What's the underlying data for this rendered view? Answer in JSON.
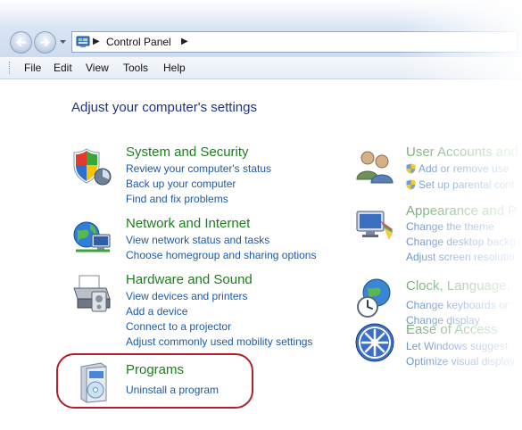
{
  "address": {
    "crumb": "Control Panel"
  },
  "menu": {
    "items": [
      "File",
      "Edit",
      "View",
      "Tools",
      "Help"
    ]
  },
  "page": {
    "heading": "Adjust your computer's settings"
  },
  "categories": {
    "system": {
      "title": "System and Security",
      "links": [
        "Review your computer's status",
        "Back up your computer",
        "Find and fix problems"
      ]
    },
    "network": {
      "title": "Network and Internet",
      "links": [
        "View network status and tasks",
        "Choose homegroup and sharing options"
      ]
    },
    "hardware": {
      "title": "Hardware and Sound",
      "links": [
        "View devices and printers",
        "Add a device",
        "Connect to a projector",
        "Adjust commonly used mobility settings"
      ]
    },
    "programs": {
      "title": "Programs",
      "links": [
        "Uninstall a program"
      ]
    },
    "users": {
      "title": "User Accounts and",
      "links": [
        "Add or remove use",
        "Set up parental cont"
      ]
    },
    "appearance": {
      "title": "Appearance and P",
      "links": [
        "Change the theme",
        "Change desktop backg",
        "Adjust screen resolutio"
      ]
    },
    "clock": {
      "title": "Clock, Language,",
      "links": [
        "Change keyboards or",
        "Change display"
      ]
    },
    "ease": {
      "title": "Ease of Access",
      "links": [
        "Let Windows suggest",
        "Optimize visual display"
      ]
    }
  },
  "colors": {
    "category_title": "#1e7d1e",
    "link": "#1e5aa8",
    "heading": "#1e3287",
    "highlight": "#b21e2d"
  },
  "icons": {
    "system": "shield-icon",
    "network": "globe-network-icon",
    "hardware": "printer-icon",
    "programs": "software-box-icon",
    "users": "users-icon",
    "appearance": "monitor-palette-icon",
    "clock": "globe-clock-icon",
    "ease": "accessibility-icon"
  }
}
